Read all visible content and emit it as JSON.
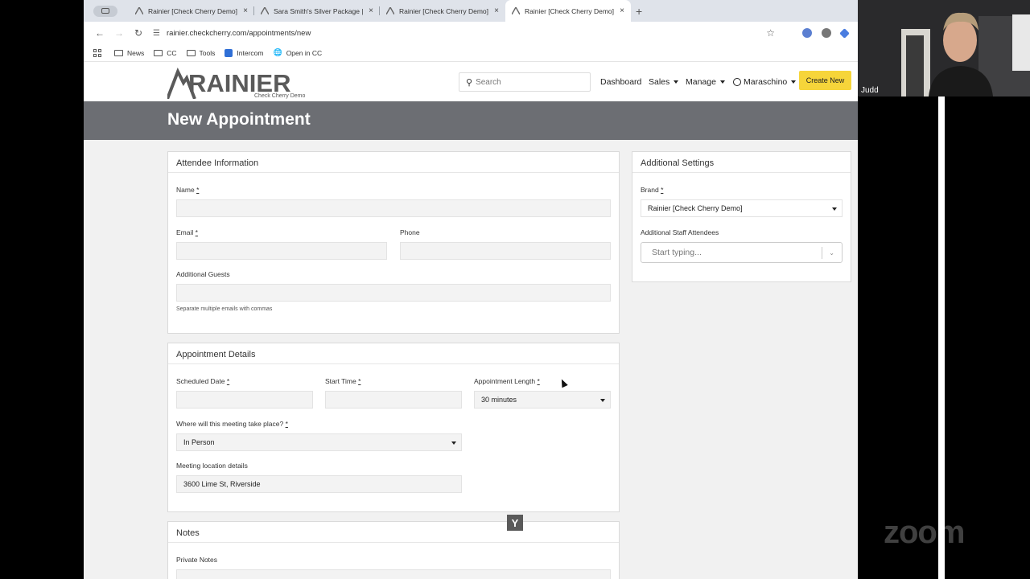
{
  "browser": {
    "tabs": [
      {
        "title": "Rainier [Check Cherry Demo]",
        "active": false
      },
      {
        "title": "Sara Smith's Silver Package |",
        "active": false
      },
      {
        "title": "Rainier [Check Cherry Demo]",
        "active": false
      },
      {
        "title": "Rainier [Check Cherry Demo]",
        "active": true
      }
    ],
    "tab_close": "×",
    "new_tab": "+",
    "url": "rainier.checkcherry.com/appointments/new",
    "bookmarks": [
      {
        "label": "News",
        "icon": "folder-icon"
      },
      {
        "label": "CC",
        "icon": "folder-icon"
      },
      {
        "label": "Tools",
        "icon": "folder-icon"
      },
      {
        "label": "Intercom",
        "icon": "intercom-icon"
      },
      {
        "label": "Open in CC",
        "icon": "globe-icon"
      }
    ]
  },
  "header": {
    "logo_text": "RAINIER",
    "logo_subtitle": "Check Cherry Demo",
    "search_placeholder": "Search",
    "nav": {
      "dashboard": "Dashboard",
      "sales": "Sales",
      "manage": "Manage",
      "user": "Maraschino"
    },
    "create_new": "Create New"
  },
  "page": {
    "title": "New Appointment"
  },
  "attendee": {
    "heading": "Attendee Information",
    "name_label": "Name",
    "email_label": "Email",
    "phone_label": "Phone",
    "guests_label": "Additional Guests",
    "guests_hint": "Separate multiple emails with commas",
    "required_mark": "*"
  },
  "details": {
    "heading": "Appointment Details",
    "date_label": "Scheduled Date",
    "start_label": "Start Time",
    "length_label": "Appointment Length",
    "length_value": "30 minutes",
    "where_label": "Where will this meeting take place?",
    "where_value": "In Person",
    "location_label": "Meeting location details",
    "location_value": "3600 Lime St, Riverside"
  },
  "notes": {
    "heading": "Notes",
    "private_label": "Private Notes"
  },
  "settings": {
    "heading": "Additional Settings",
    "brand_label": "Brand",
    "brand_value": "Rainier [Check Cherry Demo]",
    "staff_label": "Additional Staff Attendees",
    "staff_placeholder": "Start typing..."
  },
  "overlay": {
    "participant_name": "Judd",
    "y_badge": "Y",
    "watermark": "zoom"
  }
}
